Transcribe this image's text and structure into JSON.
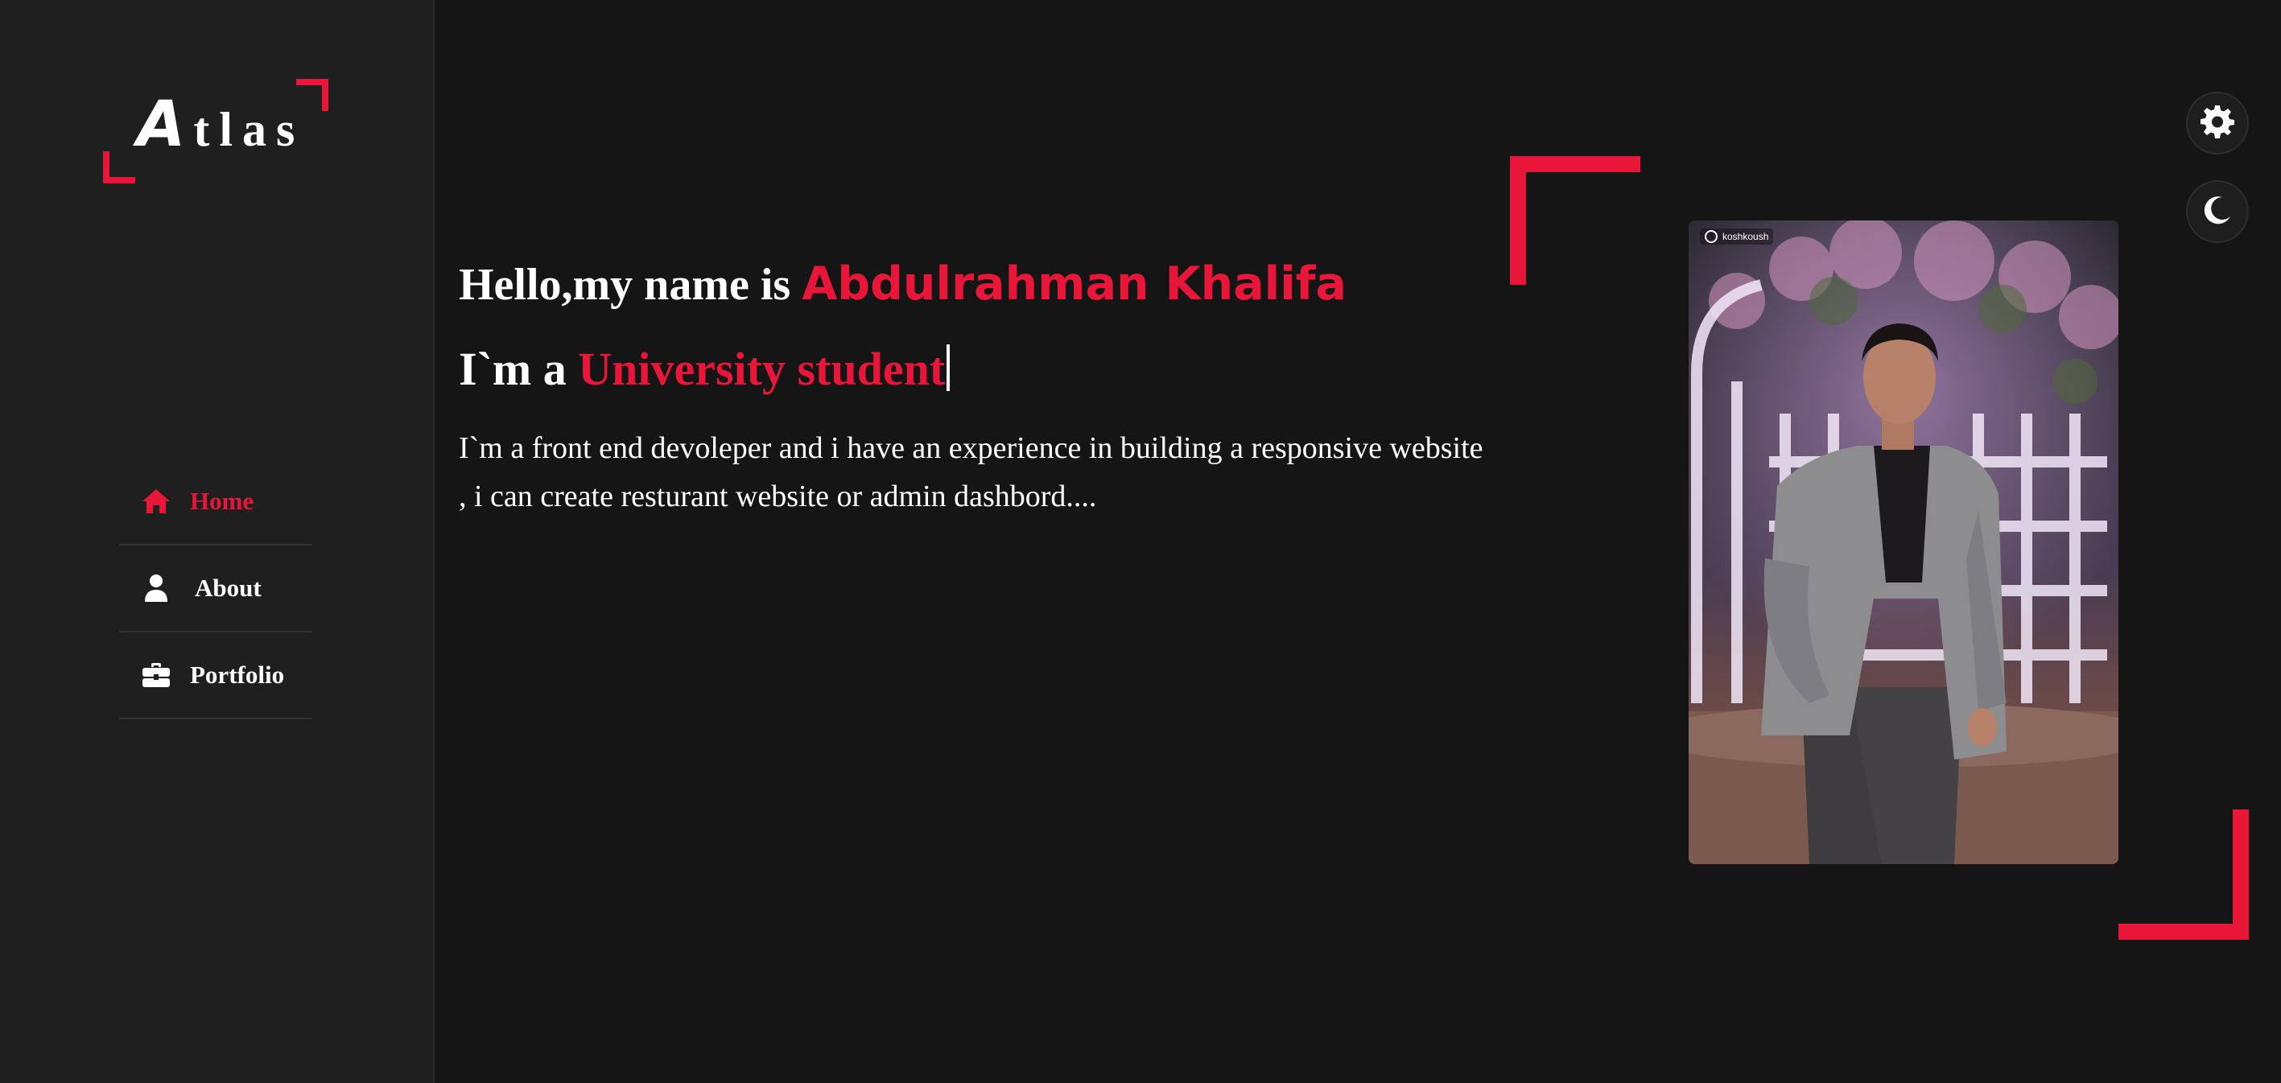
{
  "logo": {
    "first_letter": "A",
    "rest": "tlas"
  },
  "nav": {
    "items": [
      {
        "label": "Home",
        "icon": "home-icon",
        "active": true
      },
      {
        "label": "About",
        "icon": "user-icon",
        "active": false
      },
      {
        "label": "Portfolio",
        "icon": "briefcase-icon",
        "active": false
      }
    ]
  },
  "hero": {
    "greeting": "Hello,my name is ",
    "name": "Abdulrahman Khalifa",
    "role_prefix": "I`m a ",
    "role": "University student",
    "description_line1": "I`m a front end devoleper and i have an experience in building a responsive website",
    "description_line2": ", i can create resturant website or admin dashbord...."
  },
  "photo": {
    "tag_text": "koshkoush"
  },
  "controls": {
    "settings_icon": "gear-icon",
    "theme_icon": "moon-icon"
  },
  "colors": {
    "accent": "#e8173a",
    "background": "#151515",
    "sidebar": "#1f1f1f",
    "text": "#ffffff"
  }
}
